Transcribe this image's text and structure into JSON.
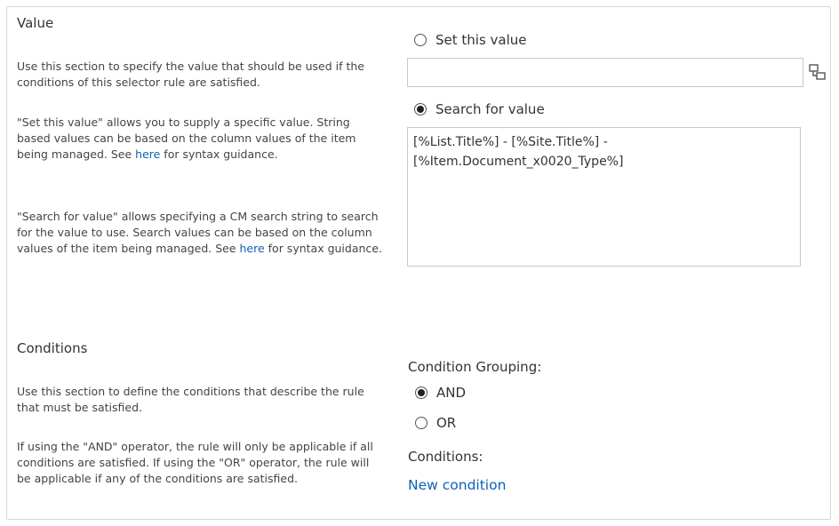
{
  "value_section": {
    "title": "Value",
    "desc1": "Use this section to specify the value that should be used if the conditions of this selector rule are satisfied.",
    "desc2_before": "\"Set this value\" allows you to supply a specific value. String based values can be based on the column values of the item being managed. See ",
    "desc2_link": "here",
    "desc2_after": " for syntax guidance.",
    "desc3_before": "\"Search for value\" allows specifying a  CM search string to search for the value to use. Search values can be based on the column values of the item being managed. See ",
    "desc3_link": "here",
    "desc3_after": " for syntax guidance.",
    "set_value_label": "Set this value",
    "set_value_text": "",
    "search_value_label": "Search for value",
    "search_value_text": "[%List.Title%] - [%Site.Title%] - [%Item.Document_x0020_Type%]",
    "set_value_selected": false,
    "search_value_selected": true,
    "picker_icon": "field-picker-icon"
  },
  "conditions_section": {
    "title": "Conditions",
    "desc1": "Use this section to define the conditions that describe the rule that must be satisfied.",
    "desc2": "If using the \"AND\" operator, the rule will only be applicable if all conditions are satisfied. If using the \"OR\" operator, the rule will be applicable if any of the conditions are satisfied.",
    "grouping_label": "Condition Grouping:",
    "and_label": "AND",
    "or_label": "OR",
    "and_selected": true,
    "or_selected": false,
    "conditions_label": "Conditions:",
    "new_condition_link": "New condition"
  },
  "colors": {
    "link": "#0b63b3",
    "border": "#c8c8c8"
  }
}
